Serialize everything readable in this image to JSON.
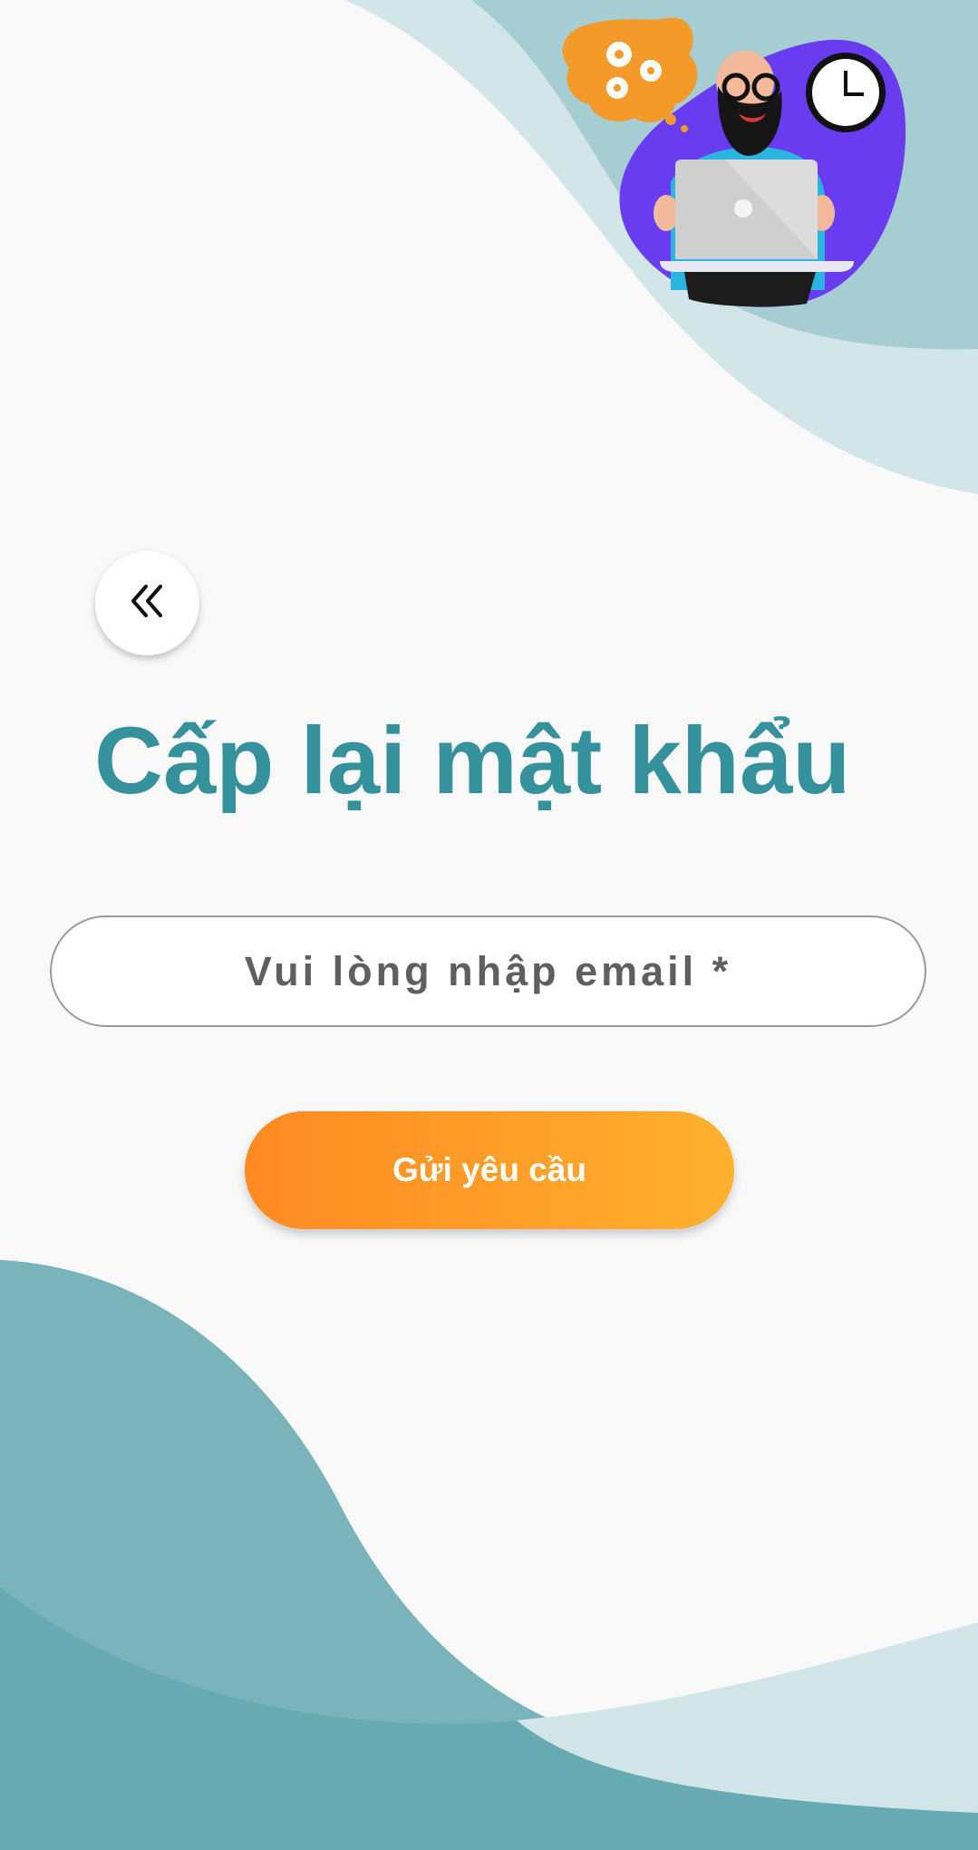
{
  "screen": {
    "title": "Cấp lại mật khẩu"
  },
  "form": {
    "email_placeholder": "Vui lòng nhập email *",
    "email_value": "",
    "submit_label": "Gửi yêu cầu"
  },
  "icons": {
    "back": "double-chevron-left-icon",
    "illustration": "man-with-laptop-illustration"
  },
  "colors": {
    "background": "#f9f9f9",
    "title": "#35919b",
    "wave_light": "#cfe3e6",
    "wave_mid": "#a4ccd1",
    "wave_dark": "#67aab2",
    "button_start": "#ff8a22",
    "button_end": "#ffb02e",
    "input_border": "#9a9a9a",
    "placeholder": "#5f5f5f"
  }
}
